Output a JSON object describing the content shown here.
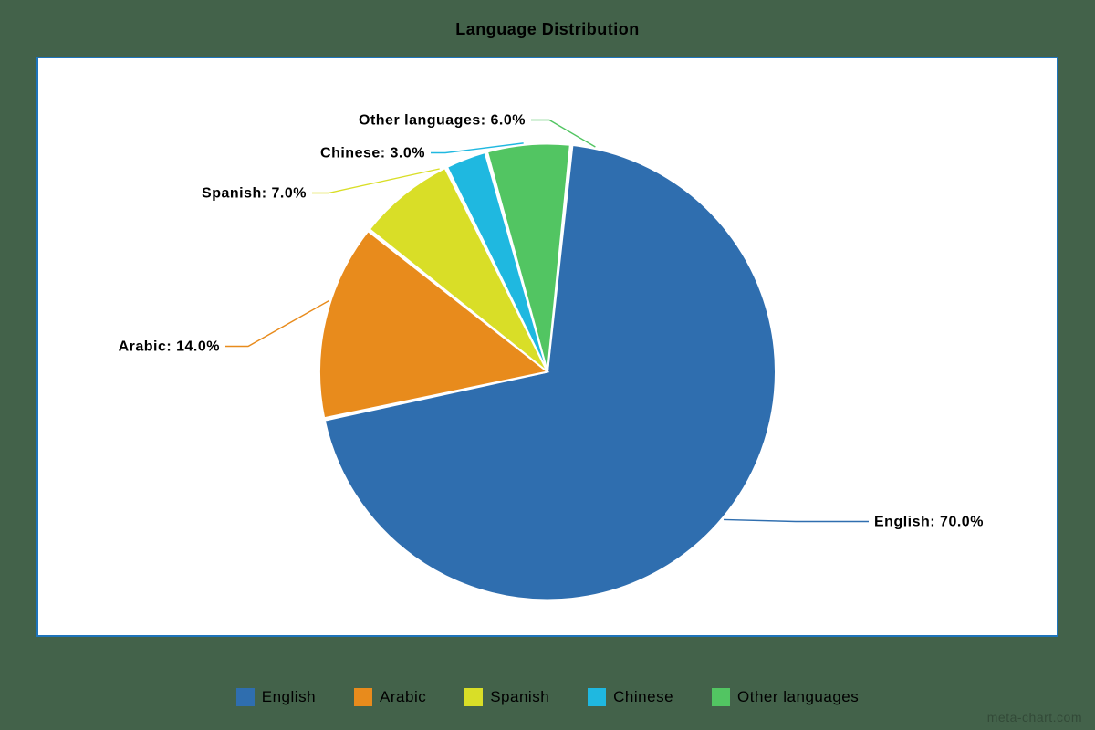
{
  "chart_data": {
    "type": "pie",
    "title": "Language Distribution",
    "series": [
      {
        "name": "English",
        "value": 70.0,
        "color": "#2f6eaf"
      },
      {
        "name": "Arabic",
        "value": 14.0,
        "color": "#e88b1c"
      },
      {
        "name": "Spanish",
        "value": 7.0,
        "color": "#d9de27"
      },
      {
        "name": "Chinese",
        "value": 3.0,
        "color": "#1fb8e0"
      },
      {
        "name": "Other languages",
        "value": 6.0,
        "color": "#52c562"
      }
    ],
    "legend_position": "bottom",
    "watermark": "meta-chart.com"
  }
}
